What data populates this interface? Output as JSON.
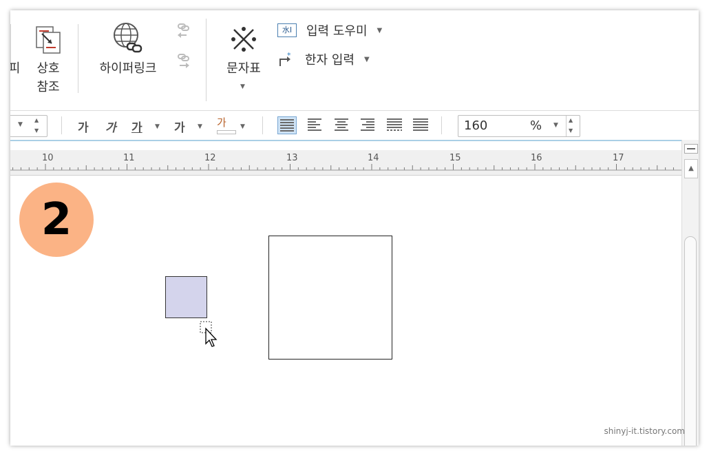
{
  "ribbon": {
    "partial_label": "피",
    "cross_ref_label_1": "상호",
    "cross_ref_label_2": "참조",
    "hyperlink_label": "하이퍼링크",
    "charmap_label": "문자표",
    "input_helper_label": "입력 도우미",
    "hanja_label": "한자 입력"
  },
  "format_bar": {
    "char_bold": "가",
    "char_italic": "가",
    "char_underline": "가",
    "char_strike": "가",
    "char_color": "가",
    "line_spacing_value": "160",
    "line_spacing_unit": "%"
  },
  "ruler": {
    "marks": [
      "10",
      "11",
      "12",
      "13",
      "14",
      "15",
      "16",
      "17"
    ]
  },
  "document": {
    "step_badge": "2"
  },
  "watermark": "shinyj-it.tistory.com",
  "colors": {
    "badge": "#fbb385",
    "small_shape_fill": "#d4d4ec",
    "ruler_accent": "#a9cfe6"
  }
}
